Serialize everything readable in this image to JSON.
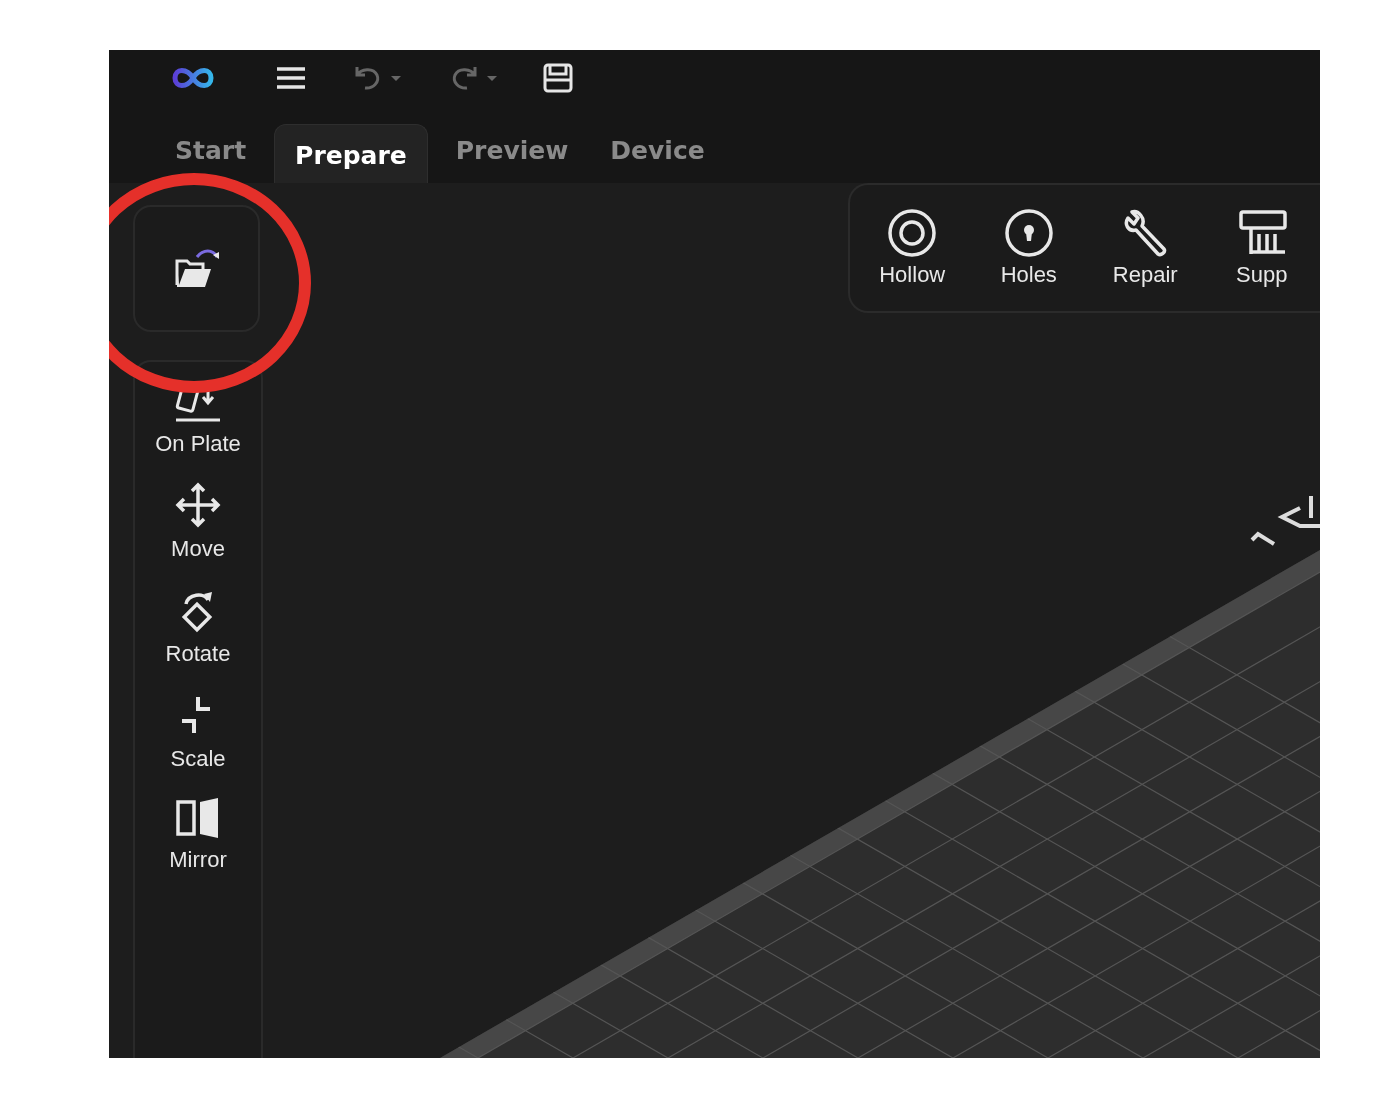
{
  "toolbar": [
    {
      "kind": "logo",
      "disabled": false
    },
    {
      "kind": "menu",
      "disabled": false
    },
    {
      "kind": "undo",
      "disabled": true
    },
    {
      "kind": "redo",
      "disabled": true
    },
    {
      "kind": "save",
      "disabled": false
    }
  ],
  "tabs": [
    {
      "label": "Start",
      "selected": false
    },
    {
      "label": "Prepare",
      "selected": true
    },
    {
      "label": "Preview",
      "selected": false
    },
    {
      "label": "Device",
      "selected": false
    }
  ],
  "side_tools": [
    {
      "kind": "onplate",
      "label": "On Plate"
    },
    {
      "kind": "move",
      "label": "Move"
    },
    {
      "kind": "rotate",
      "label": "Rotate"
    },
    {
      "kind": "scale",
      "label": "Scale"
    },
    {
      "kind": "mirror",
      "label": "Mirror"
    }
  ],
  "top_tools": [
    {
      "kind": "hollow",
      "label": "Hollow"
    },
    {
      "kind": "holes",
      "label": "Holes"
    },
    {
      "kind": "repair",
      "label": "Repair"
    },
    {
      "kind": "support",
      "label": "Supp"
    }
  ]
}
